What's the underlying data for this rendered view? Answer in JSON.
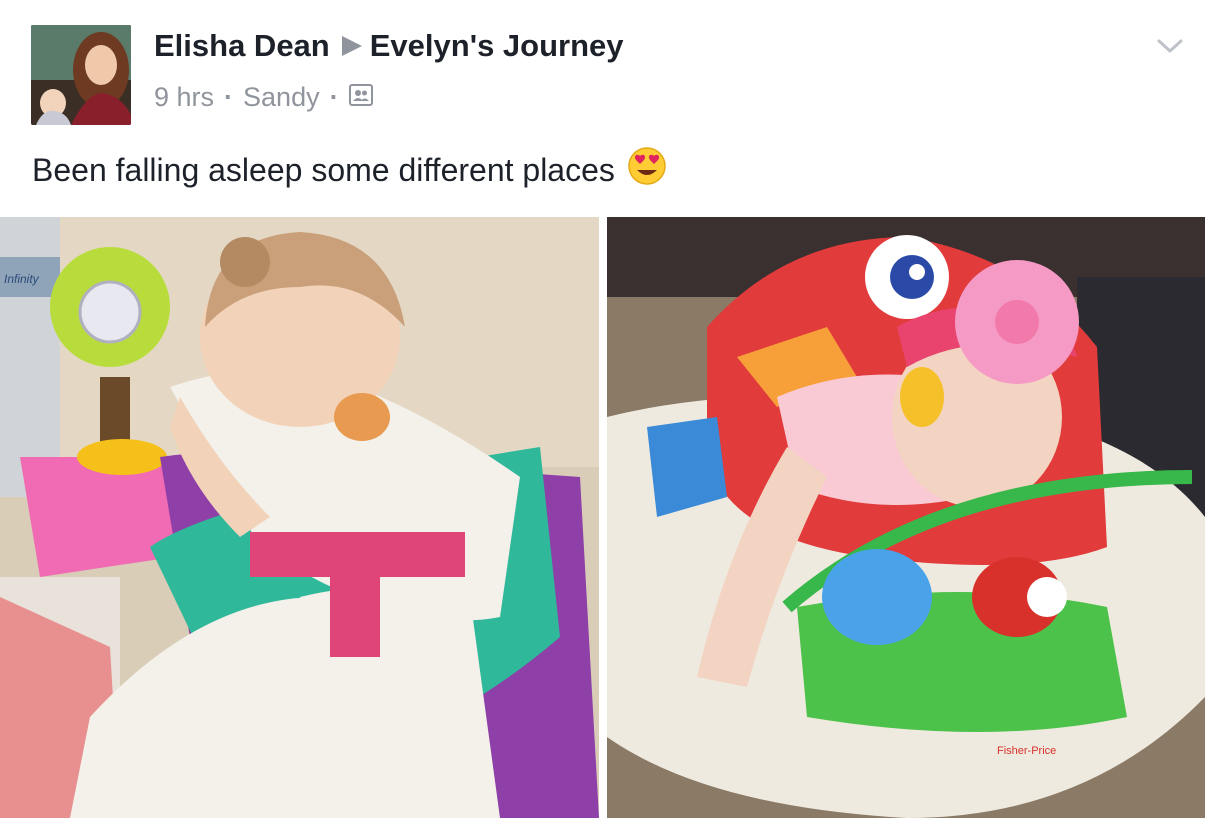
{
  "header": {
    "author": "Elisha Dean",
    "group": "Evelyn's Journey",
    "time": "9 hrs",
    "location": "Sandy",
    "privacy_icon": "group-audience-icon"
  },
  "post": {
    "text": "Been falling asleep some different places",
    "emoji": "heart-eyes-emoji"
  },
  "photos": {
    "left_label": "Infinity",
    "right_label": "Fisher-Price"
  },
  "colors": {
    "text": "#1d2129",
    "meta": "#90949c"
  }
}
